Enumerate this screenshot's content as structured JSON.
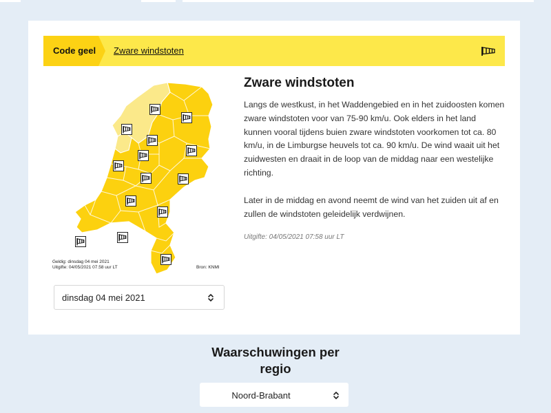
{
  "banner": {
    "code_label": "Code geel",
    "warning_link": "Zware windstoten",
    "icon": "windsock-icon"
  },
  "map": {
    "legend_valid": "Geldig: dinsdag 04 mei 2021",
    "legend_issued": "Uitgifte: 04/05/2021 07.58 uur LT",
    "source": "Bron: KNMI",
    "colors": {
      "warning": "#fcd10f",
      "light": "#fbe98a",
      "border": "#ffffff"
    },
    "marker_icon": "windsock-icon"
  },
  "date_select": {
    "value": "dinsdag 04 mei 2021"
  },
  "article": {
    "title": "Zware windstoten",
    "paragraph1": "Langs de westkust, in het Waddengebied en in het zuidoosten komen zware windstoten voor van 75-90 km/u. Ook elders in het land kunnen vooral tijdens buien zware windstoten voorkomen tot ca. 80 km/u, in de Limburgse heuvels tot ca. 90 km/u. De wind waait uit het zuidwesten en draait in de loop van de middag naar een westelijke richting.",
    "paragraph2": "Later in de middag en avond neemt de wind van het zuiden uit af en zullen de windstoten geleidelijk verdwijnen.",
    "issued": "Uitgifte: 04/05/2021 07:58 uur LT"
  },
  "regions": {
    "title": "Waarschuwingen per regio",
    "selected": "Noord-Brabant"
  },
  "colors": {
    "page_bg": "#e4edf6",
    "banner_yellow": "#fde84a",
    "code_yellow": "#fcd214"
  }
}
